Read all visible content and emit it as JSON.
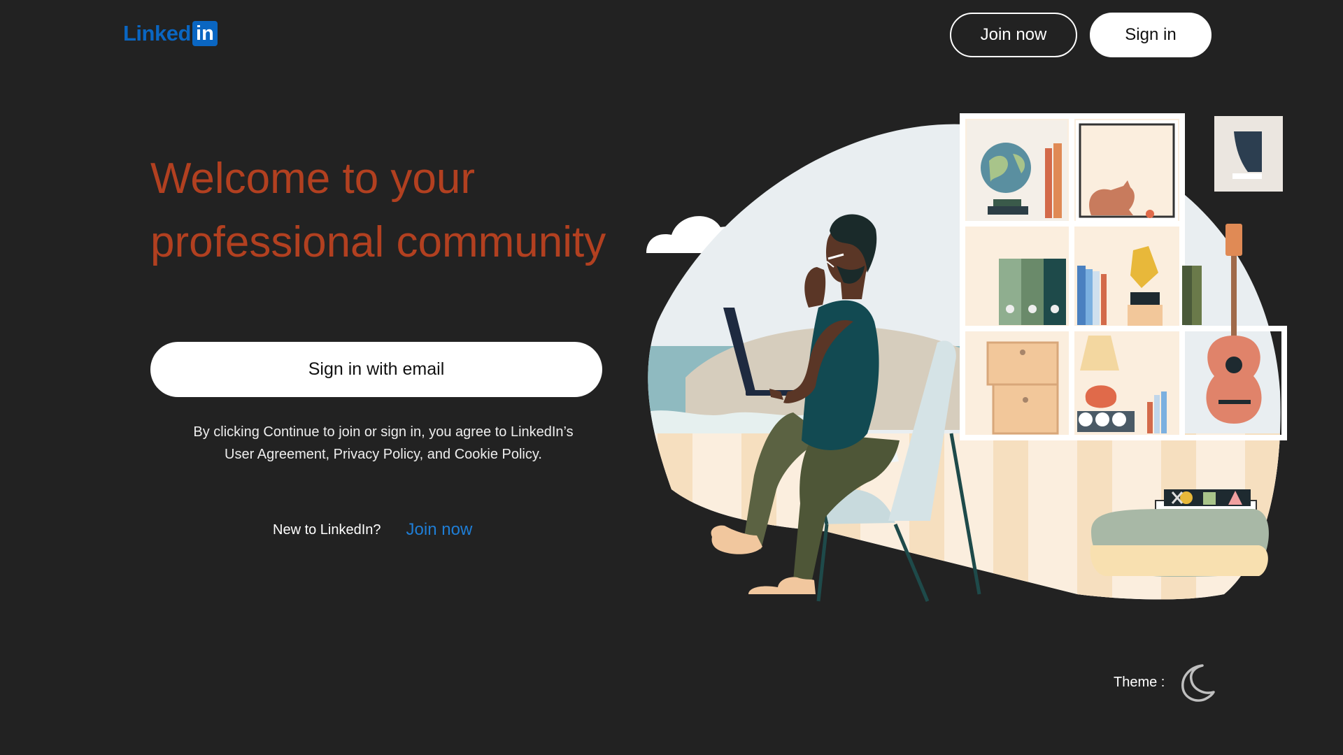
{
  "header": {
    "logo_text": "Linked",
    "logo_badge": "in",
    "join_now_label": "Join now",
    "sign_in_label": "Sign in"
  },
  "hero": {
    "headline_line1": "Welcome to your",
    "headline_line2": "professional community",
    "sign_in_email_label": "Sign in with email",
    "legal_line1": "By clicking Continue to join or sign in, you agree to LinkedIn’s",
    "legal_line2": "User Agreement, Privacy Policy, and Cookie Policy.",
    "new_to_text": "New to LinkedIn?",
    "join_now_link": "Join now"
  },
  "theme": {
    "label": "Theme :",
    "icon": "moon-icon"
  },
  "colors": {
    "background": "#222222",
    "brand_blue": "#0a66c2",
    "headline": "#b24020",
    "link": "#1f7ed6"
  }
}
